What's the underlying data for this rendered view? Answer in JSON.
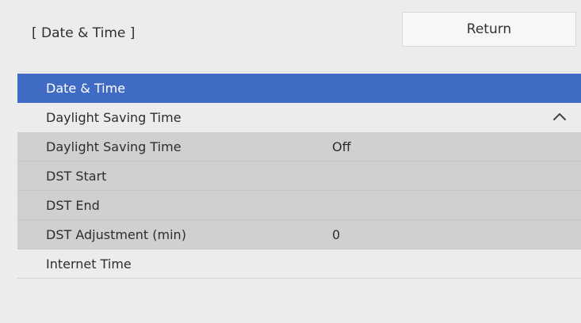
{
  "header": {
    "title": "[ Date & Time ]",
    "return_label": "Return"
  },
  "menu": {
    "items": [
      {
        "label": "Date & Time",
        "value": "",
        "state": "selected"
      },
      {
        "label": "Daylight Saving Time",
        "value": "",
        "state": "expanded",
        "icon": "chevron-up-icon"
      },
      {
        "label": "Daylight Saving Time",
        "value": "Off"
      },
      {
        "label": "DST Start",
        "value": ""
      },
      {
        "label": "DST End",
        "value": ""
      },
      {
        "label": "DST Adjustment (min)",
        "value": "0"
      },
      {
        "label": "Internet Time",
        "value": ""
      }
    ]
  },
  "colors": {
    "selected_bg": "#3f6bc5",
    "panel_bg": "#ececec",
    "sub_bg": "#d0d0d0"
  }
}
